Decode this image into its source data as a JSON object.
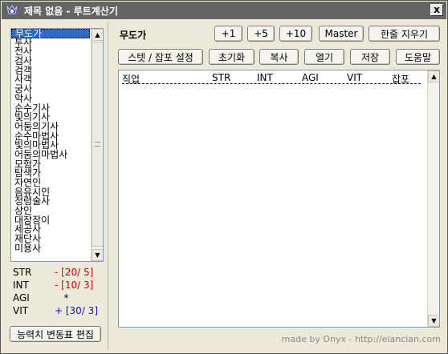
{
  "window": {
    "title": "제목 없음 - 루트계산기",
    "close_label": "x"
  },
  "jobs": {
    "items": [
      "무도가",
      "투사",
      "전사",
      "검사",
      "검객",
      "사객",
      "궁사",
      "악사",
      "순수기사",
      "빛의기사",
      "어둠의기사",
      "순수마법사",
      "빛의마법사",
      "어둠의마법사",
      "모험가",
      "탐색가",
      "자연인",
      "음유시인",
      "정령술사",
      "상인",
      "대장장이",
      "세공사",
      "재단사",
      "미용사"
    ],
    "selected_index": 0
  },
  "stats": [
    {
      "name": "STR",
      "value": "- [20/ 5]",
      "tone": "neg"
    },
    {
      "name": "INT",
      "value": "- [10/ 3]",
      "tone": "neg"
    },
    {
      "name": "AGI",
      "value": "   *",
      "tone": "plain"
    },
    {
      "name": "VIT",
      "value": "+ [30/ 3]",
      "tone": "pos"
    }
  ],
  "edit_table_button": "능력치 변동표 편집",
  "job_title": "무도가",
  "row1_buttons": {
    "plus1": "+1",
    "plus5": "+5",
    "plus10": "+10",
    "master": "Master",
    "clear_line": "한줄 지우기"
  },
  "row2_buttons": {
    "stat_skill_settings": "스텟 / 잡포 설정",
    "reset": "초기화",
    "copy": "복사",
    "open": "열기",
    "save": "저장",
    "help": "도움말"
  },
  "output": {
    "columns": [
      "직업",
      "STR",
      "INT",
      "AGI",
      "VIT",
      "잡포"
    ]
  },
  "footer": "made by Onyx - http://elancian.com"
}
